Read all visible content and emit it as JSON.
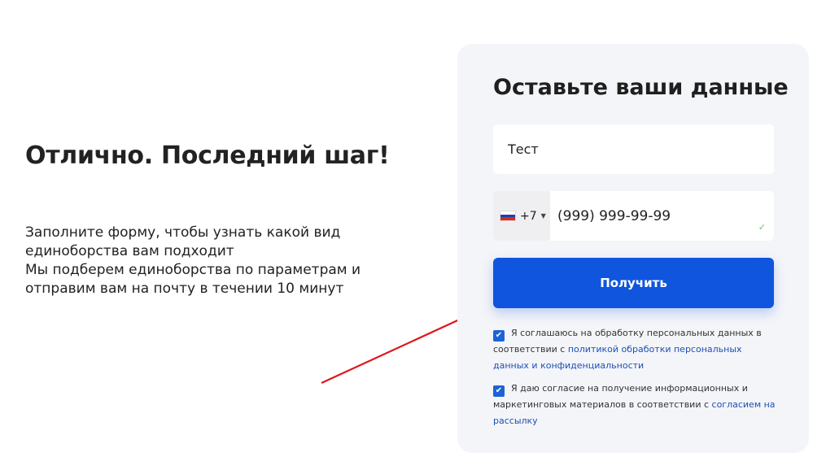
{
  "left": {
    "headline": "Отлично. Последний шаг!",
    "description": [
      "Заполните форму, чтобы узнать какой вид",
      "единоборства вам подходит",
      "Мы подберем единоборства по параметрам и",
      "отправим вам на почту в течении 10 минут"
    ]
  },
  "form": {
    "title": "Оставьте ваши данные",
    "name_value": "Тест",
    "phone": {
      "country_code": "+7",
      "value": "(999) 999-99-99",
      "flag_icon": "russia-flag-icon"
    },
    "submit_label": "Получить",
    "consent_1": {
      "checked": true,
      "text": "Я соглашаюсь на обработку персональных данных в соответствии с ",
      "link": "политикой обработки персональных данных и конфиденциальности"
    },
    "consent_2": {
      "checked": true,
      "text": "Я даю согласие на получение информационных и маркетинговых материалов в соответствии с ",
      "link": "согласием на рассылку"
    }
  },
  "colors": {
    "accent": "#0f55de",
    "card_bg": "#f4f5f9",
    "arrow": "#e0161b",
    "link": "#1d4fb3"
  }
}
